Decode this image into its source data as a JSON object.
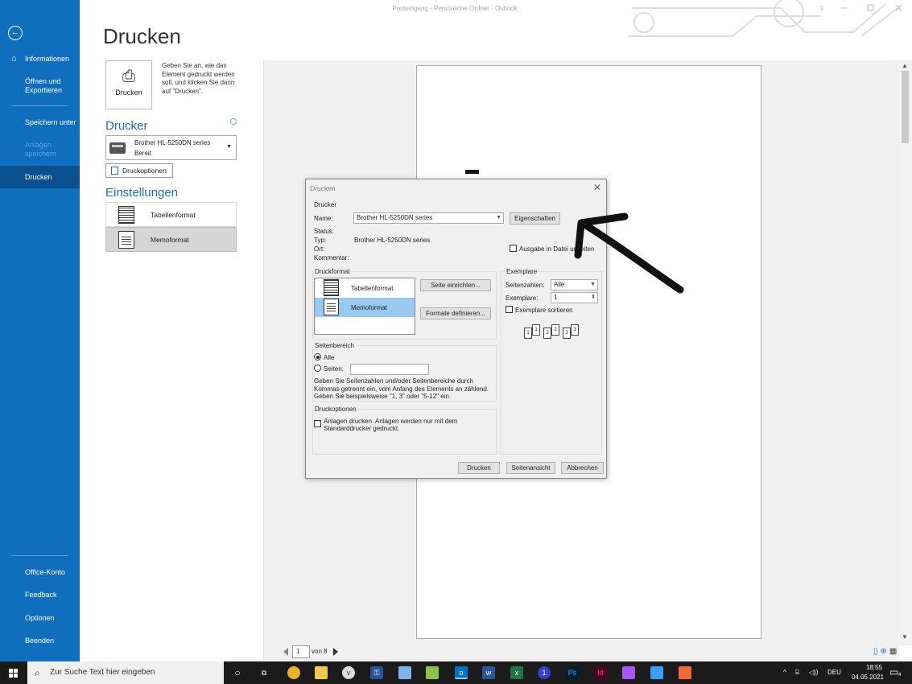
{
  "window": {
    "title": "Posteingang - Persönliche Ordner - Outlook",
    "help": "?"
  },
  "nav": {
    "back_icon": "back-arrow-icon",
    "items": [
      {
        "label": "Informationen",
        "icon": "home-icon"
      },
      {
        "label": "Öffnen und Exportieren"
      },
      {
        "label": "Speichern unter"
      },
      {
        "label": "Anlagen speichern",
        "disabled": true
      },
      {
        "label": "Drucken",
        "active": true
      }
    ],
    "bottom_items": [
      {
        "label": "Office-Konto"
      },
      {
        "label": "Feedback"
      },
      {
        "label": "Optionen"
      },
      {
        "label": "Beenden"
      }
    ]
  },
  "page_title": "Drucken",
  "print_button_label": "Drucken",
  "print_description": "Geben Sie an, wie das Element gedruckt werden soll, und klicken Sie dann auf \"Drucken\".",
  "printer_section": {
    "heading": "Drucker",
    "printer_name": "Brother HL-5250DN series",
    "printer_status": "Bereit",
    "options_button": "Druckoptionen"
  },
  "settings_section": {
    "heading": "Einstellungen",
    "formats": [
      {
        "label": "Tabellenformat",
        "selected": false
      },
      {
        "label": "Memoformat",
        "selected": true
      }
    ]
  },
  "pager": {
    "current": "1",
    "of_text": "von 8"
  },
  "dialog": {
    "title": "Drucken",
    "printer_group": "Drucker",
    "name_label": "Name:",
    "name_value": "Brother HL-5250DN series",
    "properties_button": "Eigenschaften",
    "status_label": "Status:",
    "type_label": "Typ:",
    "type_value": "Brother HL-5250DN series",
    "location_label": "Ort:",
    "comment_label": "Kommentar:",
    "output_file_label": "Ausgabe in Datei umleiten",
    "format_group": "Druckformat",
    "formats": [
      "Tabellenformat",
      "Memoformat"
    ],
    "page_setup_button": "Seite einrichten...",
    "define_formats_button": "Formate definieren...",
    "copies_group": "Exemplare",
    "page_numbers_label": "Seitenzahlen:",
    "page_numbers_value": "Alle",
    "copies_label": "Exemplare:",
    "copies_value": "1",
    "collate_label": "Exemplare sortieren",
    "range_group": "Seitenbereich",
    "range_all": "Alle",
    "range_pages": "Seiten:",
    "range_help": "Geben Sie Seitenzahlen und/oder Seitenbereiche durch Kommas getrennt ein, vom Anfang des Elements an zählend. Geben Sie beispielsweise \"1, 3\" oder \"5-12\" ein.",
    "options_group": "Druckoptionen",
    "attachments_label": "Anlagen drucken. Anlagen werden nur mit dem Standarddrucker gedruckt.",
    "print_button": "Drucken",
    "preview_button": "Seitenansicht",
    "cancel_button": "Abbrechen"
  },
  "taskbar": {
    "search_placeholder": "Zur Suche Text hier eingeben",
    "language": "DEU",
    "time": "18:55",
    "date": "04.05.2021",
    "notification_count": "4"
  }
}
